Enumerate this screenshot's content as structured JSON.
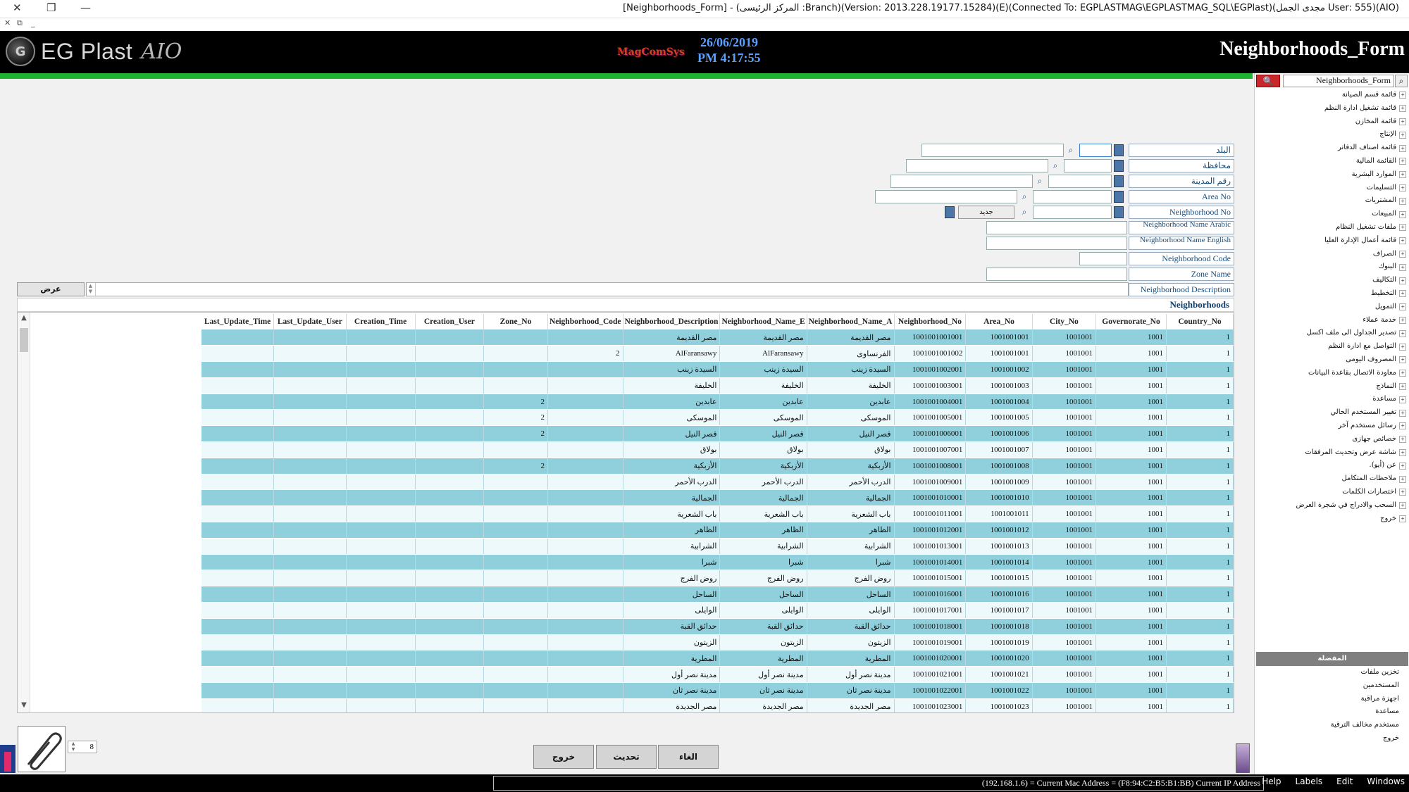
{
  "window": {
    "title": "[Neighborhoods_Form] - (المركز الرئيسى :Branch)(Version: 2013.228.19177.15284)(E)(Connected To: EGPLASTMAG\\EGPLASTMAG_SQL\\EGPlast)(مجدى الجمل User: 555)(AIO)"
  },
  "header": {
    "logo_name": "EG Plast",
    "logo_suffix": "AIO",
    "brand": "MagComSys",
    "date": "26/06/2019",
    "time": "PM 4:17:55",
    "form_title": "Neighborhoods_Form"
  },
  "side_panel": {
    "search_value": "Neighborhoods_Form",
    "tree_items": [
      "قائمة قسم الصيانة",
      "قائمة تشغيل ادارة النظم",
      "قائمة المخازن",
      "الإنتاج",
      "قائمة اصناف الدفاتر",
      "القائمة المالية",
      "الموارد البشرية",
      "التسليمات",
      "المشتريات",
      "المبيعات",
      "ملفات تشغيل النظام",
      "قائمة أعمال الإدارة العليا",
      "الصراف",
      "البنوك",
      "التكاليف",
      "التخطيط",
      "التمويل",
      "خدمة عملاء",
      "تصدير الجداول الى ملف اكسل",
      "التواصل مع ادارة النظم",
      "المصروف اليومى",
      "معاودة الاتصال بقاعدة البيانات",
      "النماذج",
      "مساعدة",
      "تغيير المستخدم الحالي",
      "رسائل مستخدم آخر",
      "خصائص جهازى",
      "شاشة عرض وتحديث المرفقات",
      "عن (أيو).",
      "ملاحظات المتكامل",
      "اختصارات الكلمات",
      "السحب والادراج في شجرة العرض",
      "خروج"
    ],
    "divider_label": "المفضلة",
    "bottom_items": [
      "تخزين ملفات",
      "المستخدمين",
      "اجهزة مراقبة",
      "مساعدة",
      "مستخدم مخالف الترقية",
      "خروج"
    ]
  },
  "form": {
    "fields": [
      {
        "label": "البلد"
      },
      {
        "label": "محافظة"
      },
      {
        "label": "رقم المدينة"
      },
      {
        "label": "Area No"
      },
      {
        "label": "Neighborhood No"
      },
      {
        "label": "Neighborhood Name Arabic"
      },
      {
        "label": "Neighborhood Name English"
      },
      {
        "label": "Neighborhood Code"
      },
      {
        "label": "Zone Name"
      },
      {
        "label": "Neighborhood Description"
      }
    ],
    "new_button": "جديد",
    "show_button": "عرض"
  },
  "grid": {
    "caption": "Neighborhoods",
    "columns": [
      "Last_Update_Time",
      "Last_Update_User",
      "Creation_Time",
      "Creation_User",
      "Zone_No",
      "Neighborhood_Code",
      "Neighborhood_Description",
      "Neighborhood_Name_E",
      "Neighborhood_Name_A",
      "Neighborhood_No",
      "Area_No",
      "City_No",
      "Governorate_No",
      "Country_No"
    ],
    "rows": [
      [
        "",
        "",
        "",
        "",
        "",
        "",
        "مصر القديمة",
        "مصر القديمة",
        "مصر القديمة",
        "1001001001001",
        "1001001001",
        "1001001",
        "1001",
        "1"
      ],
      [
        "",
        "",
        "",
        "",
        "",
        "2",
        "AlFaransawy",
        "AlFaransawy",
        "الفرنساوى",
        "1001001001002",
        "1001001001",
        "1001001",
        "1001",
        "1"
      ],
      [
        "",
        "",
        "",
        "",
        "",
        "",
        "السيدة زينب",
        "السيدة زينب",
        "السيدة زينب",
        "1001001002001",
        "1001001002",
        "1001001",
        "1001",
        "1"
      ],
      [
        "",
        "",
        "",
        "",
        "",
        "",
        "الخليفة",
        "الخليفة",
        "الخليفة",
        "1001001003001",
        "1001001003",
        "1001001",
        "1001",
        "1"
      ],
      [
        "",
        "",
        "",
        "",
        "2",
        "",
        "عابدين",
        "عابدين",
        "عابدين",
        "1001001004001",
        "1001001004",
        "1001001",
        "1001",
        "1"
      ],
      [
        "",
        "",
        "",
        "",
        "2",
        "",
        "الموسكى",
        "الموسكى",
        "الموسكى",
        "1001001005001",
        "1001001005",
        "1001001",
        "1001",
        "1"
      ],
      [
        "",
        "",
        "",
        "",
        "2",
        "",
        "قصر النيل",
        "قصر النيل",
        "قصر النيل",
        "1001001006001",
        "1001001006",
        "1001001",
        "1001",
        "1"
      ],
      [
        "",
        "",
        "",
        "",
        "",
        "",
        "بولاق",
        "بولاق",
        "بولاق",
        "1001001007001",
        "1001001007",
        "1001001",
        "1001",
        "1"
      ],
      [
        "",
        "",
        "",
        "",
        "2",
        "",
        "الأزبكية",
        "الأزبكية",
        "الأزبكية",
        "1001001008001",
        "1001001008",
        "1001001",
        "1001",
        "1"
      ],
      [
        "",
        "",
        "",
        "",
        "",
        "",
        "الدرب الأحمر",
        "الدرب الأحمر",
        "الدرب الأحمر",
        "1001001009001",
        "1001001009",
        "1001001",
        "1001",
        "1"
      ],
      [
        "",
        "",
        "",
        "",
        "",
        "",
        "الجمالية",
        "الجمالية",
        "الجمالية",
        "1001001010001",
        "1001001010",
        "1001001",
        "1001",
        "1"
      ],
      [
        "",
        "",
        "",
        "",
        "",
        "",
        "باب الشعرية",
        "باب الشعرية",
        "باب الشعرية",
        "1001001011001",
        "1001001011",
        "1001001",
        "1001",
        "1"
      ],
      [
        "",
        "",
        "",
        "",
        "",
        "",
        "الظاهر",
        "الظاهر",
        "الظاهر",
        "1001001012001",
        "1001001012",
        "1001001",
        "1001",
        "1"
      ],
      [
        "",
        "",
        "",
        "",
        "",
        "",
        "الشرابية",
        "الشرابية",
        "الشرابية",
        "1001001013001",
        "1001001013",
        "1001001",
        "1001",
        "1"
      ],
      [
        "",
        "",
        "",
        "",
        "",
        "",
        "شبرا",
        "شبرا",
        "شبرا",
        "1001001014001",
        "1001001014",
        "1001001",
        "1001",
        "1"
      ],
      [
        "",
        "",
        "",
        "",
        "",
        "",
        "روض الفرج",
        "روض الفرج",
        "روض الفرج",
        "1001001015001",
        "1001001015",
        "1001001",
        "1001",
        "1"
      ],
      [
        "",
        "",
        "",
        "",
        "",
        "",
        "الساحل",
        "الساحل",
        "الساحل",
        "1001001016001",
        "1001001016",
        "1001001",
        "1001",
        "1"
      ],
      [
        "",
        "",
        "",
        "",
        "",
        "",
        "الوايلى",
        "الوايلى",
        "الوايلى",
        "1001001017001",
        "1001001017",
        "1001001",
        "1001",
        "1"
      ],
      [
        "",
        "",
        "",
        "",
        "",
        "",
        "حدائق القبة",
        "حدائق القبة",
        "حدائق القبة",
        "1001001018001",
        "1001001018",
        "1001001",
        "1001",
        "1"
      ],
      [
        "",
        "",
        "",
        "",
        "",
        "",
        "الزيتون",
        "الزيتون",
        "الزيتون",
        "1001001019001",
        "1001001019",
        "1001001",
        "1001",
        "1"
      ],
      [
        "",
        "",
        "",
        "",
        "",
        "",
        "المطرية",
        "المطرية",
        "المطرية",
        "1001001020001",
        "1001001020",
        "1001001",
        "1001",
        "1"
      ],
      [
        "",
        "",
        "",
        "",
        "",
        "",
        "مدينة نصر أول",
        "مدينة نصر أول",
        "مدينة نصر أول",
        "1001001021001",
        "1001001021",
        "1001001",
        "1001",
        "1"
      ],
      [
        "",
        "",
        "",
        "",
        "",
        "",
        "مدينة نصر ثان",
        "مدينة نصر ثان",
        "مدينة نصر ثان",
        "1001001022001",
        "1001001022",
        "1001001",
        "1001",
        "1"
      ],
      [
        "",
        "",
        "",
        "",
        "",
        "",
        "مصر الجديدة",
        "مصر الجديدة",
        "مصر الجديدة",
        "1001001023001",
        "1001001023",
        "1001001",
        "1001",
        "1"
      ]
    ]
  },
  "bottom": {
    "spin_value": "8",
    "buttons": {
      "exit": "خروج",
      "update": "تحديث",
      "cancel": "الغاء"
    }
  },
  "statusbar": {
    "text": "(192.168.1.6) = Current Mac Address = (F8:94:C2:B5:B1:BB) Current IP Address",
    "menu": [
      "Windows",
      "Edit",
      "Labels",
      "Help"
    ]
  },
  "colors": {
    "header_bg": "#000000",
    "accent_green": "#1fb530",
    "row_odd": "#8fd0dc",
    "row_even": "#eef9fb",
    "label_text": "#1a4d7a"
  }
}
